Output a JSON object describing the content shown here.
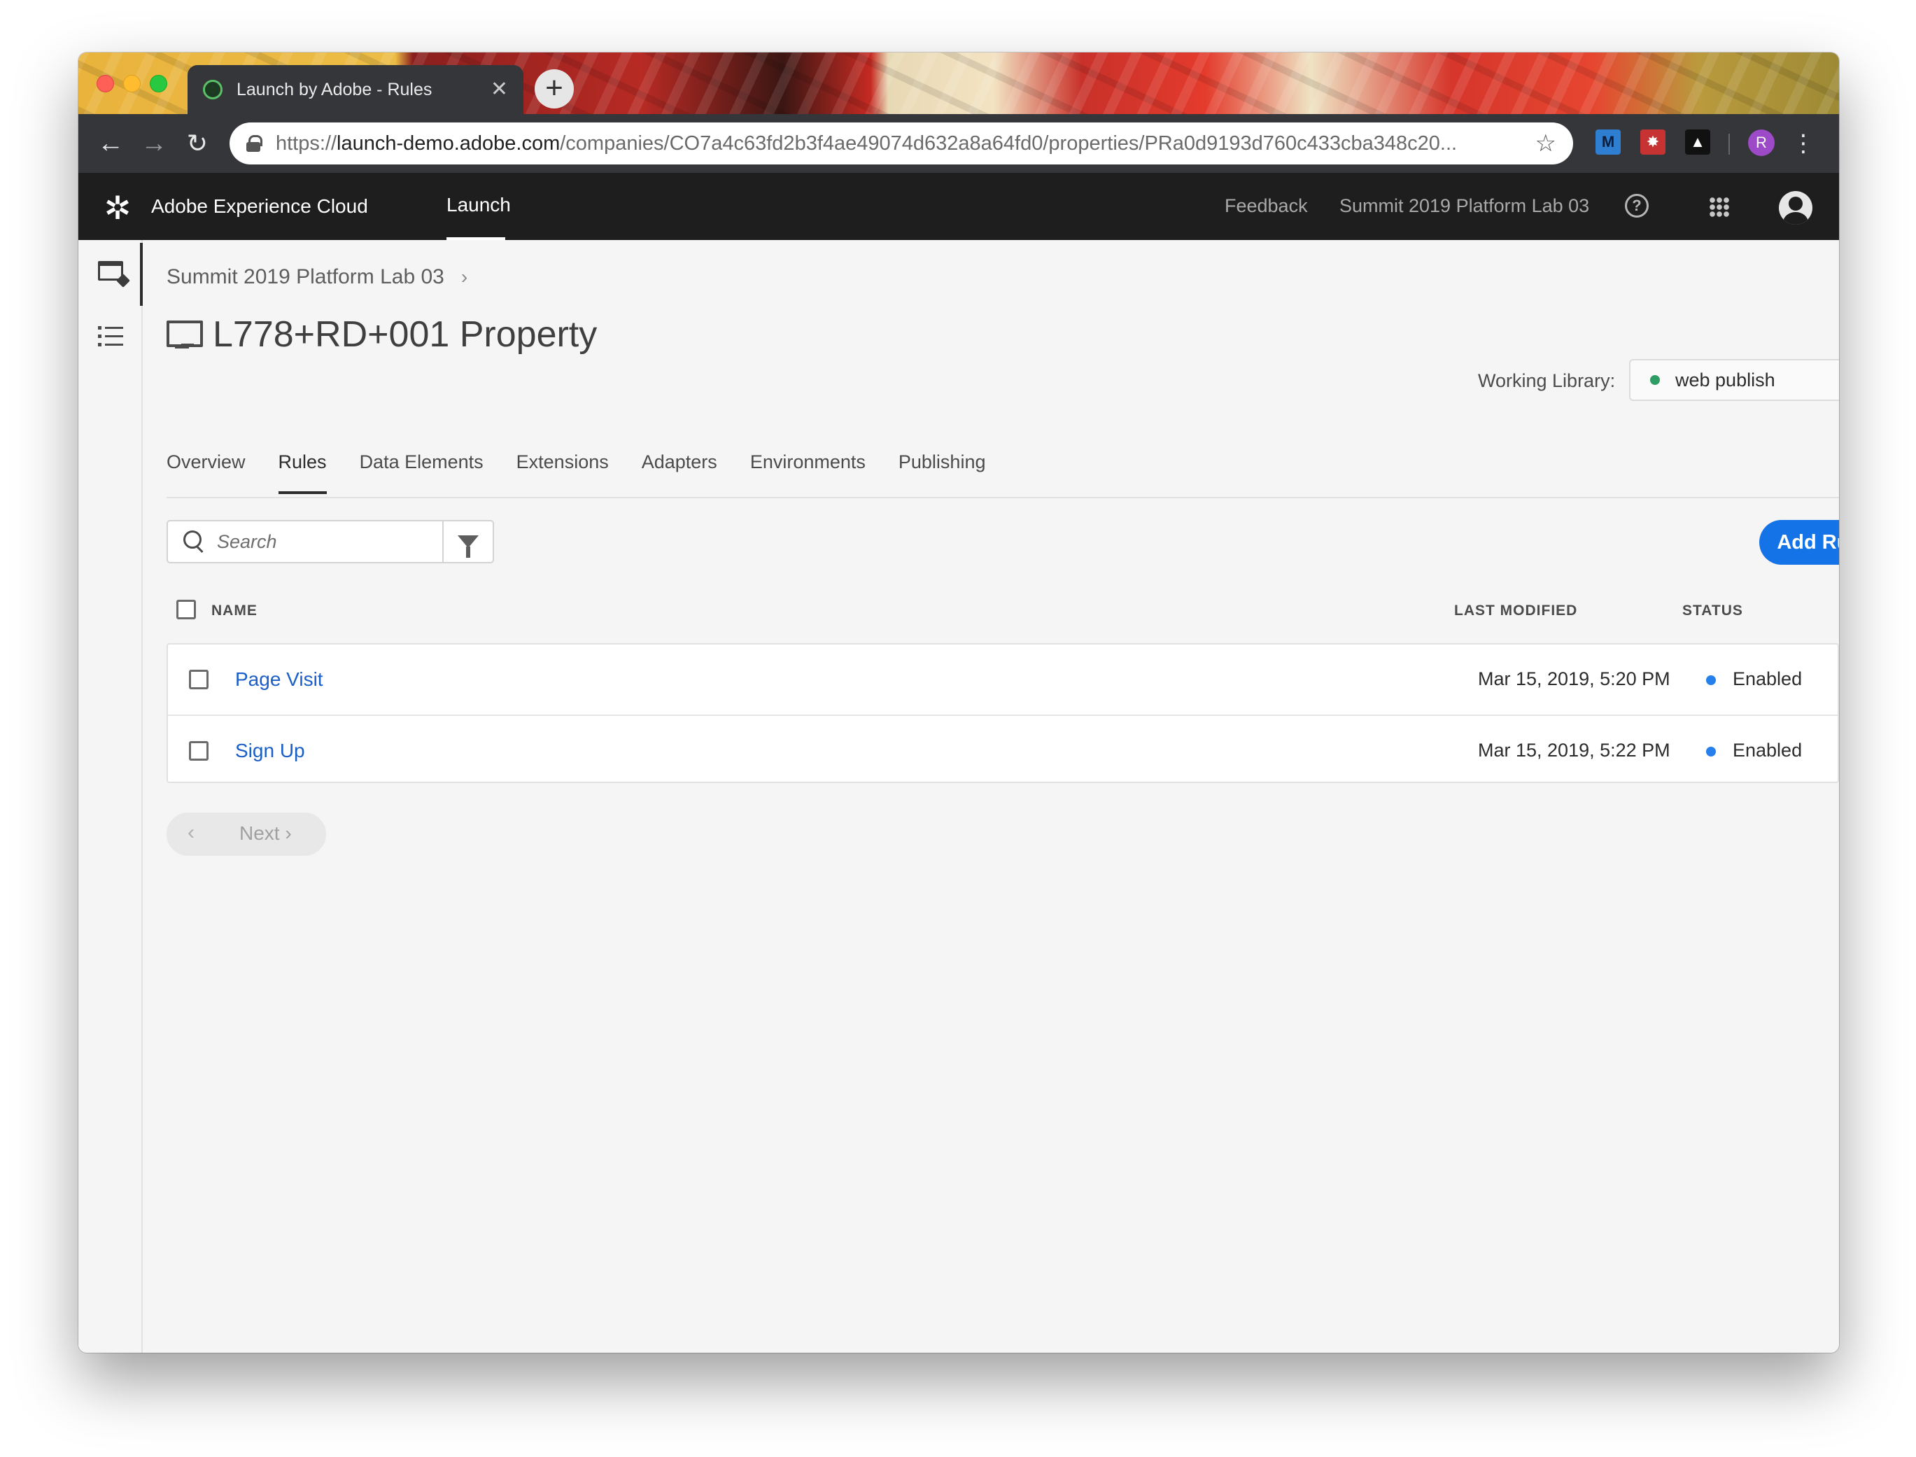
{
  "browser": {
    "tab_title": "Launch by Adobe - Rules",
    "tab_close": "✕",
    "new_tab": "+",
    "url_scheme": "https://",
    "url_host": "launch-demo.adobe.com",
    "url_path": "/companies/CO7a4c63fd2b3f4ae49074d632a8a64fd0/properties/PRa0d9193d760c433cba348c20...",
    "back": "←",
    "forward": "→",
    "reload": "↻",
    "star": "☆",
    "ext_m": "M",
    "ext_a": "✸",
    "ext_c": "▲",
    "profile_initial": "R",
    "menu": "⋮"
  },
  "header": {
    "logo": "✲",
    "brand": "Adobe Experience Cloud",
    "product_tab": "Launch",
    "feedback": "Feedback",
    "org": "Summit 2019 Platform Lab 03",
    "help": "?"
  },
  "page": {
    "breadcrumb": "Summit 2019 Platform Lab 03",
    "breadcrumb_chevron": "›",
    "title": "L778+RD+001 Property",
    "working_library_label": "Working Library:",
    "working_library_value": "web publish",
    "tabs": [
      {
        "label": "Overview"
      },
      {
        "label": "Rules"
      },
      {
        "label": "Data Elements"
      },
      {
        "label": "Extensions"
      },
      {
        "label": "Adapters"
      },
      {
        "label": "Environments"
      },
      {
        "label": "Publishing"
      }
    ],
    "active_tab": "Rules"
  },
  "toolbar": {
    "search_placeholder": "Search",
    "add_rule_label": "Add Rule"
  },
  "table": {
    "columns": {
      "name": "NAME",
      "last_modified": "LAST MODIFIED",
      "status": "STATUS"
    },
    "rows": [
      {
        "name": "Page Visit",
        "last_modified": "Mar 15, 2019, 5:20 PM",
        "status": "Enabled"
      },
      {
        "name": "Sign Up",
        "last_modified": "Mar 15, 2019, 5:22 PM",
        "status": "Enabled"
      }
    ]
  },
  "pagination": {
    "prev": "‹",
    "next": "Next ›"
  },
  "colors": {
    "accent_blue": "#1473e6",
    "link_blue": "#1a5fc7",
    "status_blue": "#2680eb",
    "library_green": "#2d9d63",
    "header_bg": "#1e1e1e"
  }
}
